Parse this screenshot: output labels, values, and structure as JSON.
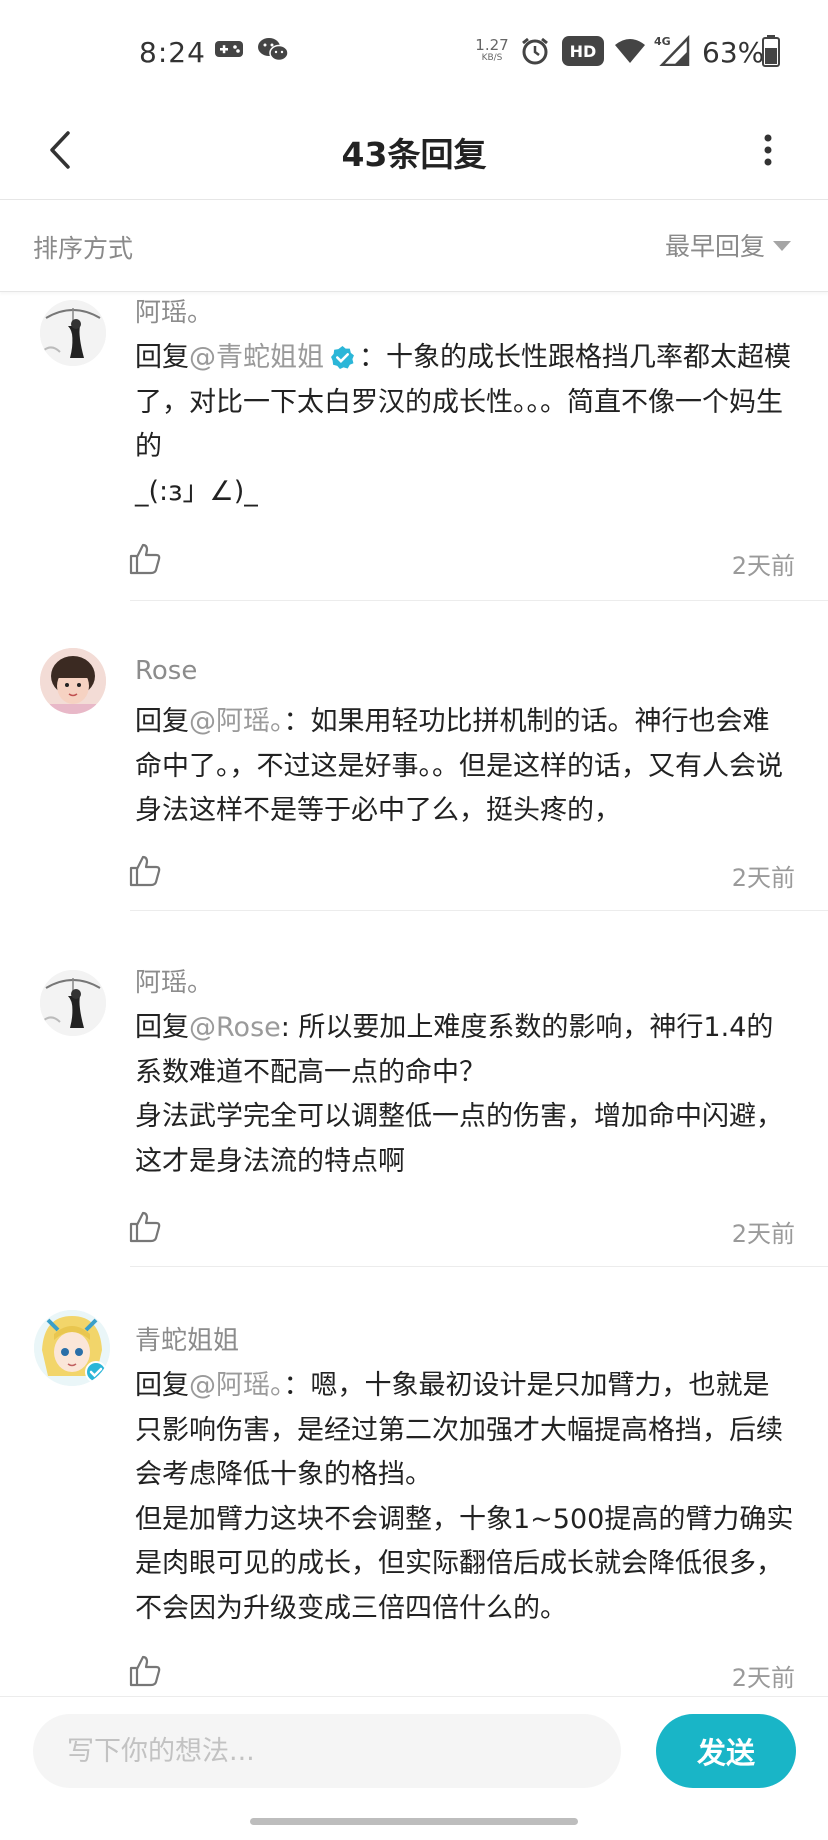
{
  "status_bar": {
    "time": "8:24",
    "net_speed_value": "1.27",
    "net_speed_unit": "KB/S",
    "hd_badge": "HD",
    "network_type": "4G",
    "battery_percent": "63%",
    "icons": [
      "gamepad-icon",
      "wechat-icon",
      "alarm-icon",
      "hd-icon",
      "wifi-icon",
      "signal-icon",
      "battery-icon"
    ]
  },
  "header": {
    "title": "43条回复",
    "back_icon": "chevron-left-icon",
    "more_icon": "more-vertical-icon"
  },
  "sort": {
    "label": "排序方式",
    "selected": "最早回复"
  },
  "comments": [
    {
      "name": "阿瑶。",
      "reply_prefix": "回复",
      "mention": "@青蛇姐姐",
      "mention_verified": true,
      "text": "：十象的成长性跟格挡几率都太超模了，对比一下太白罗汉的成长性。。。简直不像一个妈生的\n_(:з」∠)_",
      "time": "2天前"
    },
    {
      "name": "Rose",
      "reply_prefix": "回复",
      "mention": "@阿瑶。",
      "mention_verified": false,
      "text": "：如果用轻功比拼机制的话。神行也会难命中了。，不过这是好事。。但是这样的话，又有人会说身法这样不是等于必中了么，挺头疼的，",
      "time": "2天前"
    },
    {
      "name": "阿瑶。",
      "reply_prefix": "回复",
      "mention": "@Rose",
      "mention_verified": false,
      "text": ": 所以要加上难度系数的影响，神行1.4的系数难道不配高一点的命中？\n身法武学完全可以调整低一点的伤害，增加命中闪避，这才是身法流的特点啊",
      "time": "2天前"
    },
    {
      "name": "青蛇姐姐",
      "reply_prefix": "回复",
      "mention": "@阿瑶。",
      "mention_verified": false,
      "text": "：嗯，十象最初设计是只加臂力，也就是只影响伤害，是经过第二次加强才大幅提高格挡，后续会考虑降低十象的格挡。\n但是加臂力这块不会调整，十象1~500提高的臂力确实是肉眼可见的成长，但实际翻倍后成长就会降低很多，不会因为升级变成三倍四倍什么的。",
      "time": "2天前"
    }
  ],
  "composer": {
    "placeholder": "写下你的想法...",
    "value": "",
    "send_label": "发送"
  },
  "colors": {
    "accent": "#19b5c7",
    "verified": "#2bb6d8",
    "secondary_text": "#8c8c8c"
  }
}
